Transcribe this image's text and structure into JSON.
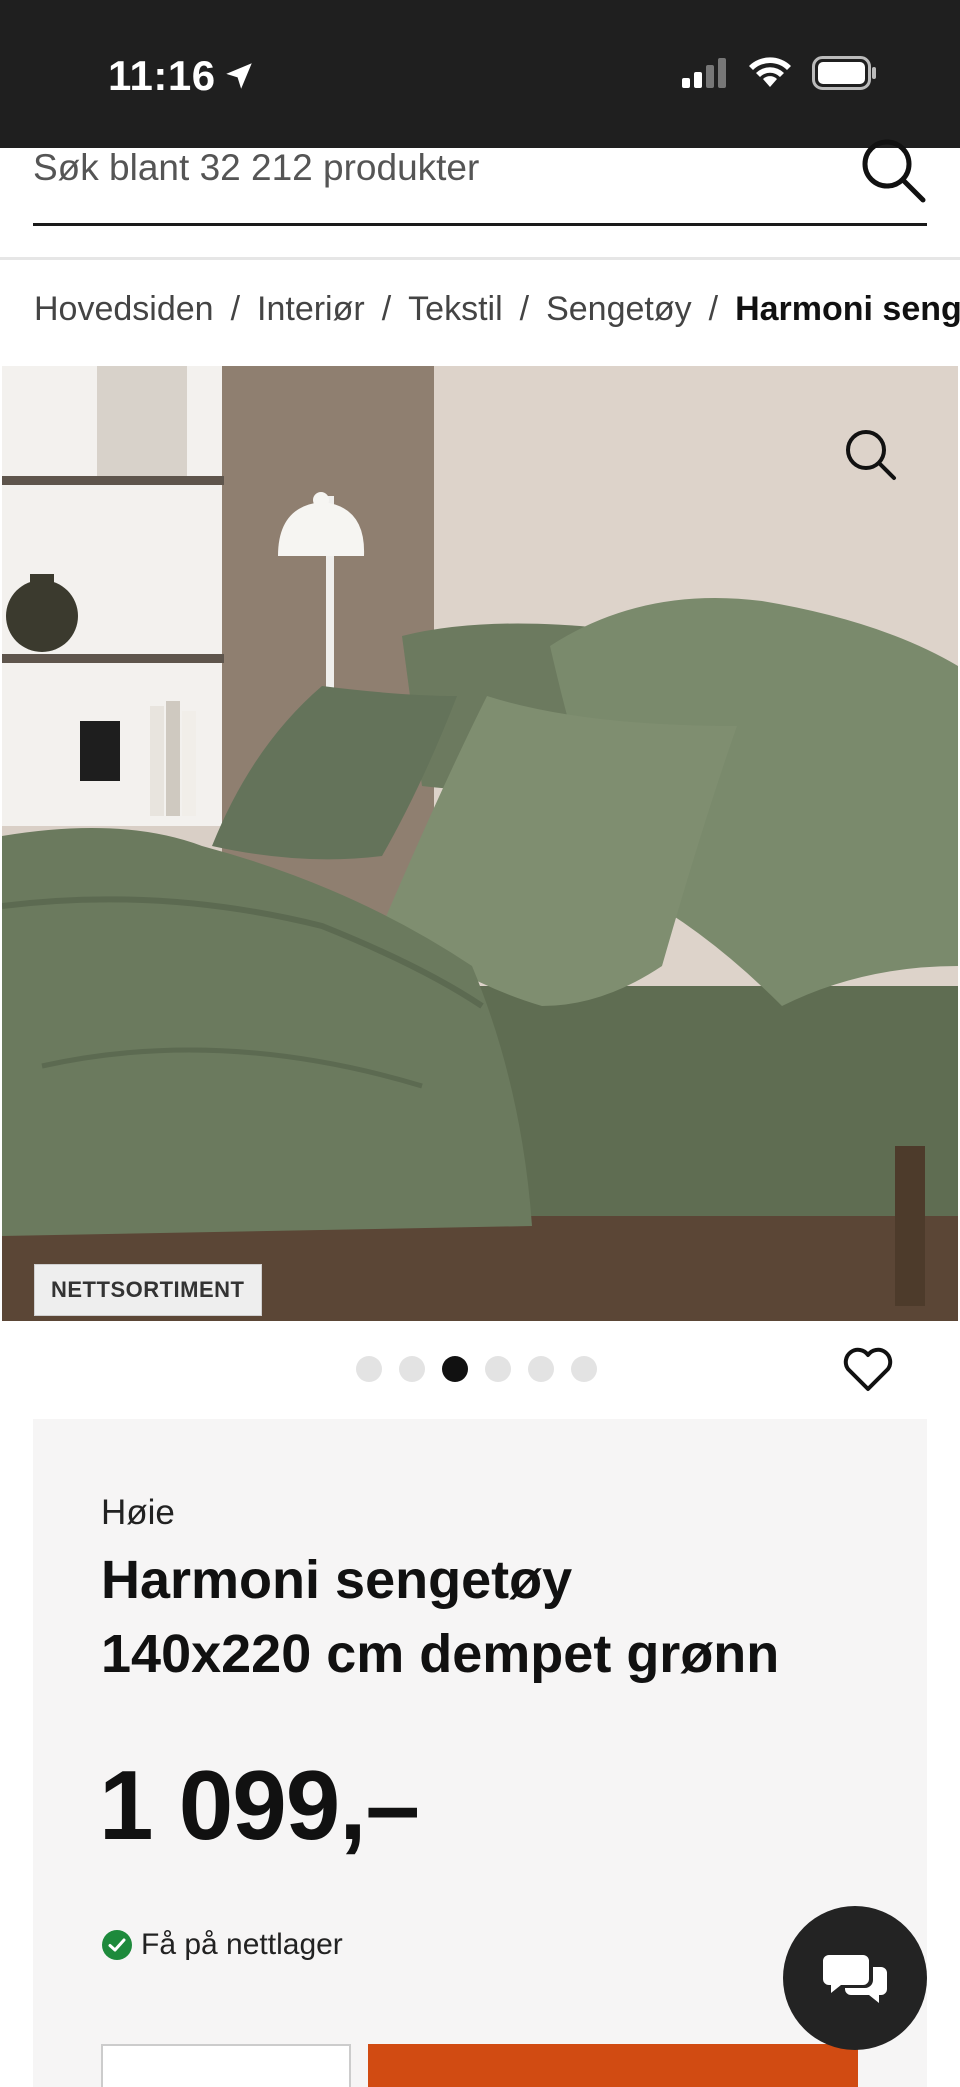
{
  "status_bar": {
    "time": "11:16"
  },
  "search": {
    "placeholder": "Søk blant 32 212 produkter"
  },
  "breadcrumb": {
    "items": [
      "Hovedsiden",
      "Interiør",
      "Tekstil",
      "Sengetøy"
    ],
    "separator": "/",
    "current": "Harmoni sengetøy"
  },
  "product_image": {
    "badge": "NETTSORTIMENT"
  },
  "carousel": {
    "total": 6,
    "active_index": 3
  },
  "product": {
    "brand": "Høie",
    "title_line1": "Harmoni sengetøy",
    "title_line2": "140x220 cm dempet grønn",
    "price": "1 099,–",
    "stock_label": "Få på nettlager"
  },
  "colors": {
    "accent": "#d14b12",
    "stock_ok": "#1e8a3c",
    "status_bar": "#1f1f1f",
    "panel_bg": "#f6f5f5"
  },
  "icons": {
    "search": "search-icon",
    "zoom": "zoom-icon",
    "favorite": "heart-icon",
    "stock": "check-circle-icon",
    "chat": "chat-icon",
    "location": "location-arrow-icon"
  }
}
